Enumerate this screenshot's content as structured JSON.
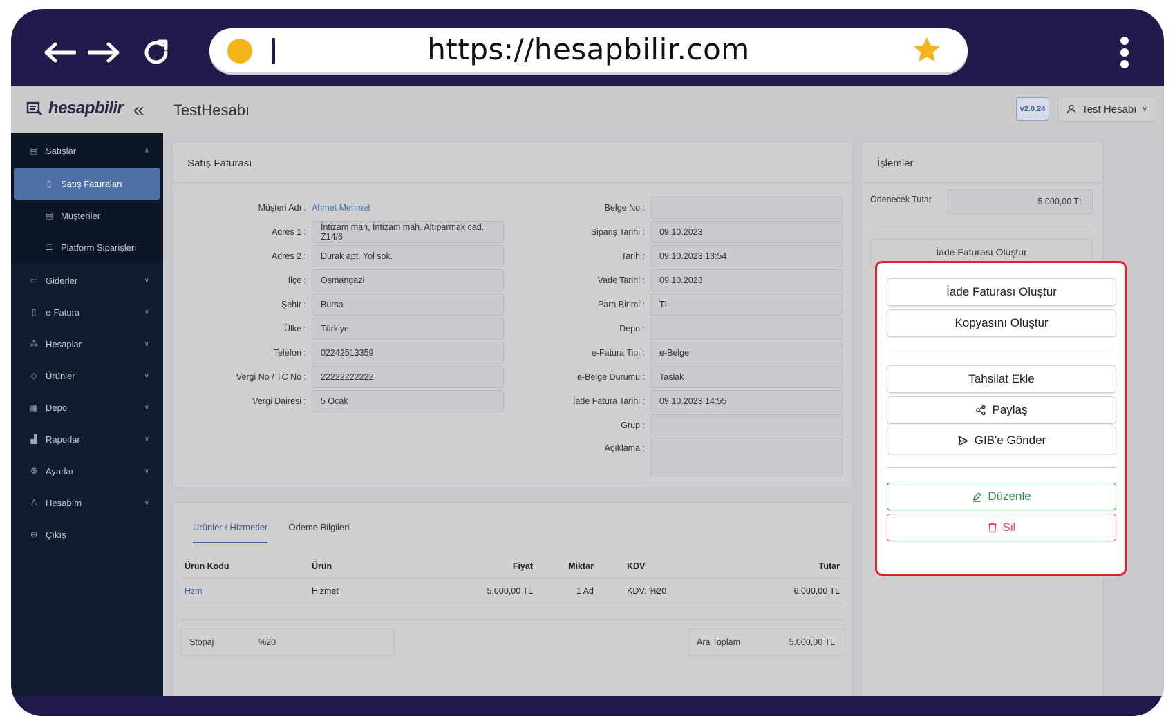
{
  "browser": {
    "url": "https://hesapbilir.com"
  },
  "header": {
    "logo_text": "hesapbilir",
    "account_title": "TestHesabı",
    "version": "v2.0.24",
    "user_label": "Test Hesabı"
  },
  "sidebar": {
    "group_label": "Satışlar",
    "sub_items": [
      {
        "label": "Satış Faturaları"
      },
      {
        "label": "Müşteriler"
      },
      {
        "label": "Platform Siparişleri"
      }
    ],
    "items": [
      {
        "label": "Giderler"
      },
      {
        "label": "e-Fatura"
      },
      {
        "label": "Hesaplar"
      },
      {
        "label": "Ürünler"
      },
      {
        "label": "Depo"
      },
      {
        "label": "Raporlar"
      },
      {
        "label": "Ayarlar"
      },
      {
        "label": "Hesabım"
      },
      {
        "label": "Çıkış"
      }
    ]
  },
  "invoice": {
    "title": "Satış Faturası",
    "left_fields": [
      {
        "label": "Müşteri Adı :",
        "value": "Ahmet Mehmet"
      },
      {
        "label": "Adres 1 :",
        "value": "İntizam mah, İntizam mah. Altıparmak cad. Z14/6"
      },
      {
        "label": "Adres 2 :",
        "value": "Durak apt. Yol sok."
      },
      {
        "label": "İlçe :",
        "value": "Osmangazi"
      },
      {
        "label": "Şehir :",
        "value": "Bursa"
      },
      {
        "label": "Ülke :",
        "value": "Türkiye"
      },
      {
        "label": "Telefon :",
        "value": "02242513359"
      },
      {
        "label": "Vergi No / TC No :",
        "value": "22222222222"
      },
      {
        "label": "Vergi Dairesi :",
        "value": "5 Ocak"
      }
    ],
    "right_fields": [
      {
        "label": "Belge No :",
        "value": ""
      },
      {
        "label": "Sipariş Tarihi :",
        "value": "09.10.2023"
      },
      {
        "label": "Tarih :",
        "value": "09.10.2023 13:54"
      },
      {
        "label": "Vade Tarihi :",
        "value": "09.10.2023"
      },
      {
        "label": "Para Birimi :",
        "value": "TL"
      },
      {
        "label": "Depo :",
        "value": ""
      },
      {
        "label": "e-Fatura Tipi :",
        "value": "e-Belge"
      },
      {
        "label": "e-Belge Durumu :",
        "value": "Taslak"
      },
      {
        "label": "İade Fatura Tarihi :",
        "value": "09.10.2023 14:55"
      },
      {
        "label": "Grup :",
        "value": ""
      },
      {
        "label": "Açıklama :",
        "value": ""
      }
    ]
  },
  "products": {
    "tabs": [
      "Ürünler / Hizmetler",
      "Ödeme Bilgileri"
    ],
    "columns": [
      "Ürün Kodu",
      "Ürün",
      "Fiyat",
      "Miktar",
      "KDV",
      "Tutar"
    ],
    "rows": [
      {
        "code": "Hzm",
        "name": "Hizmet",
        "price": "5.000,00 TL",
        "qty": "1 Ad",
        "kdv": "KDV: %20",
        "total": "6.000,00 TL"
      }
    ],
    "stopaj_label": "Stopaj",
    "stopaj_value": "%20",
    "subtotal_label": "Ara Toplam",
    "subtotal_value": "5.000,00 TL"
  },
  "operations": {
    "title": "İşlemler",
    "due_label": "Ödenecek Tutar",
    "due_value": "5.000,00 TL",
    "behind_button": "İade Faturası Oluştur"
  },
  "popup": {
    "buttons": [
      {
        "label": "İade Faturası Oluştur"
      },
      {
        "label": "Kopyasını Oluştur"
      },
      {
        "label": "Tahsilat Ekle"
      },
      {
        "label": "Paylaş"
      },
      {
        "label": "GIB'e Gönder"
      },
      {
        "label": "Düzenle"
      },
      {
        "label": "Sil"
      }
    ],
    "border_color": "#e0222c",
    "edit_color": "#2f8a4a",
    "delete_color": "#e04a52"
  }
}
